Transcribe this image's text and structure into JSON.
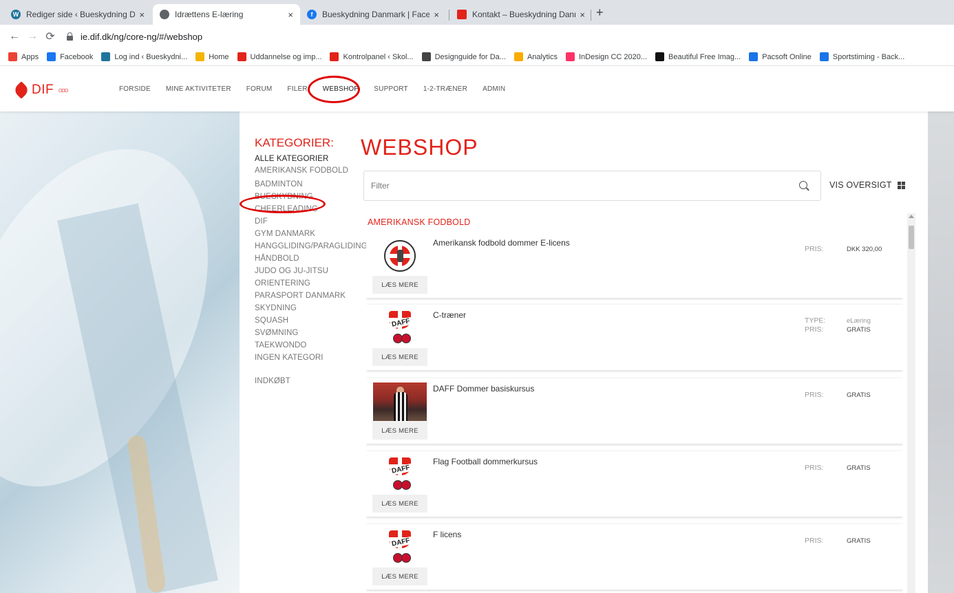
{
  "browser": {
    "tabs": [
      {
        "label": "Rediger side ‹ Bueskydning Dann",
        "icon": "wordpress-icon",
        "active": false
      },
      {
        "label": "Idrættens E-læring",
        "icon": "globe-icon",
        "active": true
      },
      {
        "label": "Bueskydning Danmark | Faceboo",
        "icon": "facebook-icon",
        "active": false
      },
      {
        "label": "Kontakt – Bueskydning Danmark",
        "icon": "site-icon",
        "active": false
      }
    ],
    "close_glyph": "×",
    "new_tab_glyph": "+",
    "url": "ie.dif.dk/ng/core-ng/#/webshop",
    "bookmarks": [
      {
        "label": "Apps",
        "color": "#ea4335"
      },
      {
        "label": "Facebook",
        "color": "#1877f2"
      },
      {
        "label": "Log ind ‹ Bueskydni...",
        "color": "#21759b"
      },
      {
        "label": "Home",
        "color": "#f4b400"
      },
      {
        "label": "Uddannelse og imp...",
        "color": "#e2231a"
      },
      {
        "label": "Kontrolpanel ‹ Skol...",
        "color": "#e2231a"
      },
      {
        "label": "Designguide for Da...",
        "color": "#444444"
      },
      {
        "label": "Analytics",
        "color": "#f9ab00"
      },
      {
        "label": "InDesign CC 2020...",
        "color": "#ff3366"
      },
      {
        "label": "Beautiful Free Imag...",
        "color": "#111111"
      },
      {
        "label": "Pacsoft Online",
        "color": "#1a73e8"
      },
      {
        "label": "Sportstiming - Back...",
        "color": "#1a73e8"
      }
    ]
  },
  "site": {
    "logo_text": "DIF",
    "nav": [
      "FORSIDE",
      "MINE AKTIVITETER",
      "FORUM",
      "FILER",
      "WEBSHOP",
      "SUPPORT",
      "1-2-TRÆNER",
      "ADMIN"
    ]
  },
  "sidebar": {
    "title": "KATEGORIER:",
    "all": "ALLE KATEGORIER",
    "categories": [
      "AMERIKANSK FODBOLD",
      "BADMINTON",
      "BUESKYDNING",
      "CHEERLEADING",
      "DIF",
      "GYM DANMARK",
      "HANGGLIDING/PARAGLIDING",
      "HÅNDBOLD",
      "JUDO OG JU-JITSU",
      "ORIENTERING",
      "PARASPORT DANMARK",
      "SKYDNING",
      "SQUASH",
      "SVØMNING",
      "TAEKWONDO",
      "INGEN KATEGORI"
    ],
    "purchased": "INDKØBT"
  },
  "main": {
    "title": "WEBSHOP",
    "filter_placeholder": "Filter",
    "overview_label": "VIS OVERSIGT",
    "section_title": "AMERIKANSK FODBOLD",
    "read_more": "LÆS MERE",
    "items": [
      {
        "title": "Amerikansk fodbold dommer E-licens",
        "type_label": "",
        "type_value": "",
        "price_label": "PRIS:",
        "price": "DKK 320,00",
        "thumb": "dommer-emblem"
      },
      {
        "title": "C-træner",
        "type_label": "TYPE:",
        "type_value": "eLæring",
        "price_label": "PRIS:",
        "price": "GRATIS",
        "thumb": "daff-logo"
      },
      {
        "title": "DAFF Dommer basiskursus",
        "type_label": "",
        "type_value": "",
        "price_label": "PRIS:",
        "price": "GRATIS",
        "thumb": "referee-photo"
      },
      {
        "title": "Flag Football dommerkursus",
        "type_label": "",
        "type_value": "",
        "price_label": "PRIS:",
        "price": "GRATIS",
        "thumb": "daff-logo"
      },
      {
        "title": "F licens",
        "type_label": "",
        "type_value": "",
        "price_label": "PRIS:",
        "price": "GRATIS",
        "thumb": "daff-logo"
      }
    ]
  },
  "colors": {
    "accent": "#e2231a",
    "annotation": "#e00000"
  }
}
